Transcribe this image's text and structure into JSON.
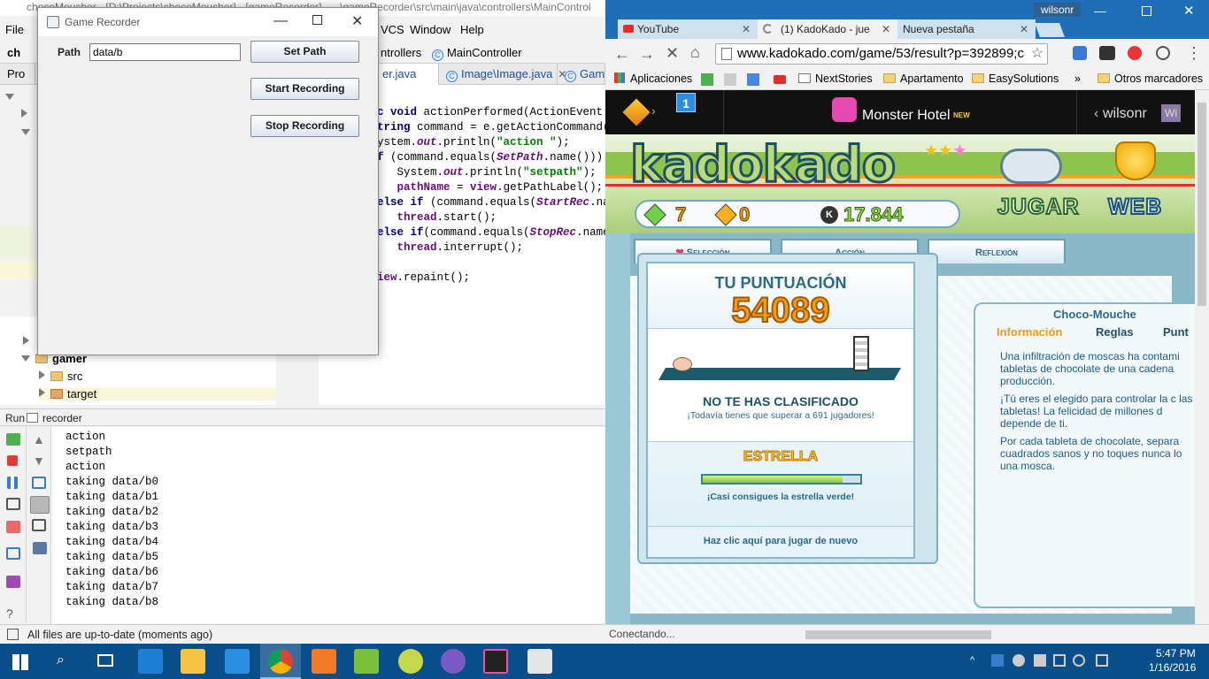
{
  "ide": {
    "title": "chocoMoucher - [D:\\Projects\\chocoMoucher] - [gameRecorder] - ...\\gameRecorder\\src\\main\\java\\controllers\\MainControl",
    "menu": [
      "File",
      "VCS",
      "Window",
      "Help"
    ],
    "nav": {
      "crumb1": "ntrollers",
      "crumb2": "MainController"
    },
    "project_short": "ch",
    "project_label_short": "Pro",
    "tabs": [
      "er.java",
      "Image\\Image.java",
      "Gam"
    ],
    "tree": {
      "gamer": "gamer",
      "src": "src",
      "target": "target"
    },
    "code": [
      "c void actionPerformed(ActionEvent e)",
      "tring command = e.getActionCommand()",
      "ystem.out.println(\"action \");",
      "f (command.equals(SetPath.name())) {",
      "  System.out.println(\"setpath\");",
      "  pathName = view.getPathLabel();",
      "else if (command.equals(StartRec.nan",
      "  thread.start();",
      "else if(command.equals(StopRec.name",
      "  thread.interrupt();",
      "iew.repaint();"
    ],
    "run": {
      "label": "Run",
      "config": "recorder"
    },
    "console": [
      "action",
      "setpath",
      "action",
      "taking data/b0",
      "taking data/b1",
      "taking data/b2",
      "taking data/b3",
      "taking data/b4",
      "taking data/b5",
      "taking data/b6",
      "taking data/b7",
      "taking data/b8"
    ],
    "status": "All files are up-to-date (moments ago)"
  },
  "dialog": {
    "title": "Game Recorder",
    "path_label": "Path",
    "path_value": "data/b",
    "set_path": "Set Path",
    "start": "Start Recording",
    "stop": "Stop Recording"
  },
  "chrome": {
    "user": "wilsonr",
    "tabs": [
      "YouTube",
      "(1) KadoKado - jue",
      "Nueva pestaña"
    ],
    "url": "www.kadokado.com/game/53/result?p=392899;c",
    "bookmarks": [
      "Aplicaciones",
      "NextStories",
      "Apartamento",
      "EasySolutions",
      "Otros marcadores"
    ],
    "status": "Conectando..."
  },
  "kadokado": {
    "notif_count": "1",
    "game_title": "Monster Hotel",
    "game_badge": "NEW",
    "user": "wilsonr",
    "user_short": "Wi",
    "logo": "kadokado",
    "counter": {
      "gems_green": "7",
      "gems_orange": "0",
      "kubor": "17.844"
    },
    "nav": [
      "JUGAR",
      "WEB"
    ],
    "tabs": [
      "Selección",
      "Acción",
      "Reflexión"
    ],
    "score_title": "TU PUNTUACIÓN",
    "score": "54089",
    "not_classified": "NO TE HAS CLASIFICADO",
    "need_beat": "¡Todavía tienes que superar a 691 jugadores!",
    "star_title": "ESTRELLA",
    "star_progress": 0.89,
    "star_msg": "¡Casi consigues la estrella verde!",
    "replay": "Haz clic aquí para jugar de nuevo",
    "info": {
      "game": "Choco-Mouche",
      "tabs": [
        "Información",
        "Reglas",
        "Punt"
      ],
      "p1": "Una infiltración de moscas ha contami tabletas de chocolate de una cadena producción.",
      "p2": "¡Tú eres el elegido para controlar la c las tabletas! La felicidad de millones d depende de ti.",
      "p3": "Por cada tableta de chocolate, separa cuadrados sanos y no toques nunca lo una mosca."
    }
  },
  "taskbar": {
    "time": "5:47 PM",
    "date": "1/16/2016"
  },
  "colors": {
    "chrome_frame": "#1f6fb8",
    "taskbar": "#0b4f8a",
    "score_orange": "#f29a1a",
    "accent_teal": "#2f6a84"
  }
}
